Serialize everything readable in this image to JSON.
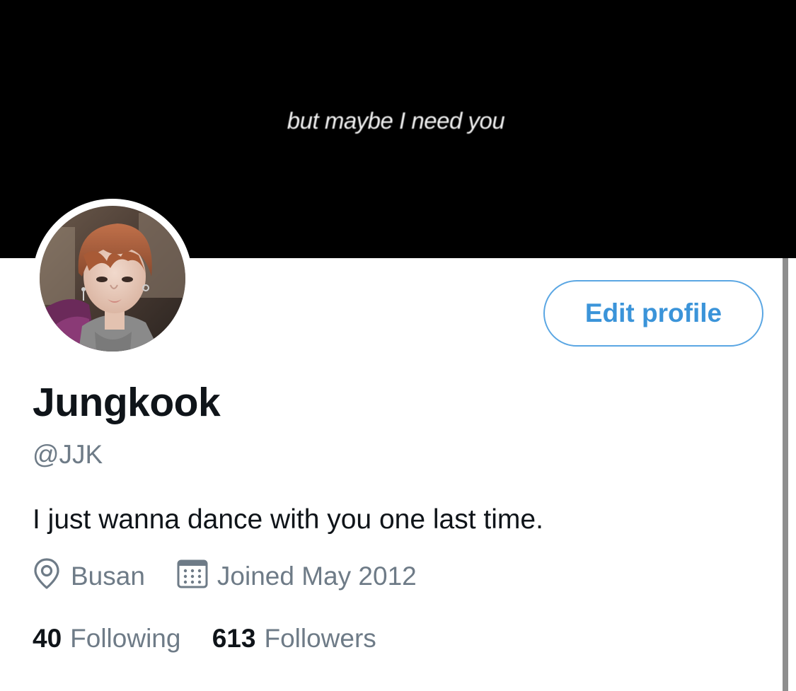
{
  "header": {
    "banner_text": "but maybe I need you"
  },
  "profile": {
    "display_name": "Jungkook",
    "handle": "@JJK",
    "bio": "I just wanna dance with you one last time.",
    "location": "Busan",
    "joined": "Joined May 2012",
    "following_count": "40",
    "following_label": "Following",
    "followers_count": "613",
    "followers_label": "Followers",
    "edit_button_label": "Edit profile"
  },
  "icons": {
    "location": "location-pin-icon",
    "joined": "calendar-icon"
  },
  "colors": {
    "accent": "#3b94d9",
    "secondary_text": "#6e7b87",
    "primary_text": "#0f1419",
    "banner": "#000000"
  }
}
